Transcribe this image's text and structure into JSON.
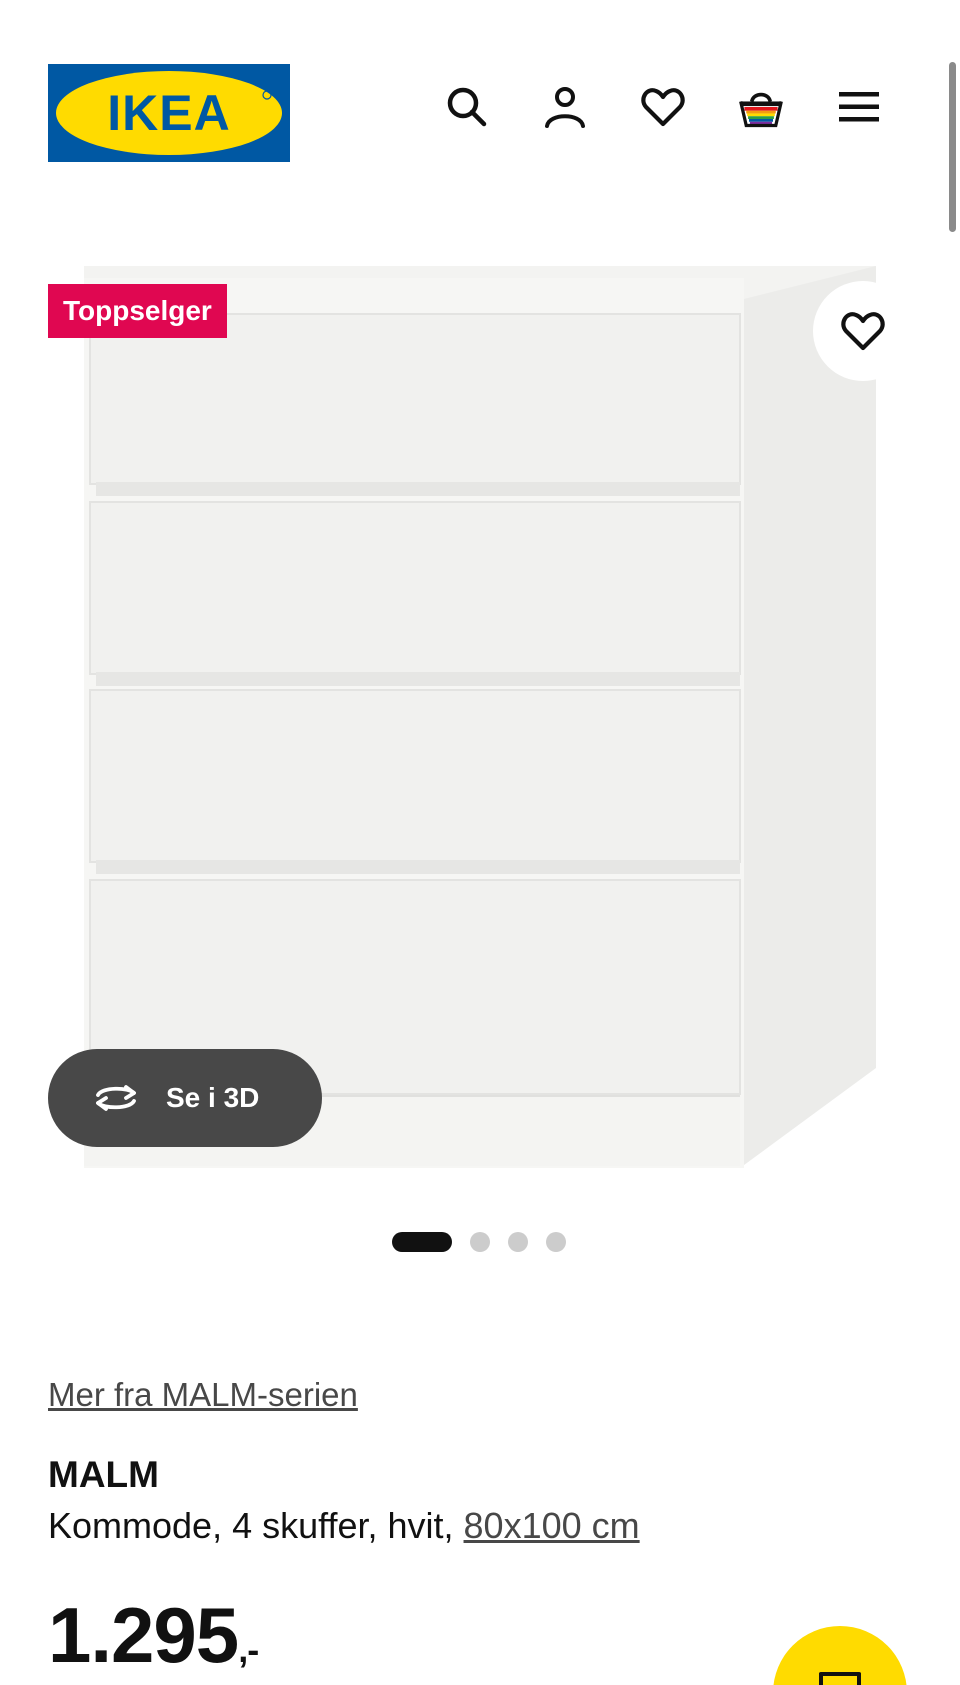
{
  "header": {
    "logo_text": "IKEA",
    "icons": [
      "search-icon",
      "account-icon",
      "favourites-icon",
      "basket-icon",
      "menu-icon"
    ]
  },
  "product_image": {
    "badge": "Toppselger",
    "view_3d_label": "Se i 3D",
    "slides_total": 4,
    "active_slide": 1
  },
  "product": {
    "series_link": "Mer fra MALM-serien",
    "name": "MALM",
    "description_prefix": "Kommode, 4 skuffer, hvit, ",
    "size_link": "80x100 cm",
    "price": "1.295",
    "price_suffix": ",-"
  },
  "colors": {
    "ikea_blue": "#0058a3",
    "ikea_yellow": "#ffdb00",
    "badge_red": "#e00751",
    "button_dark": "#484848"
  }
}
